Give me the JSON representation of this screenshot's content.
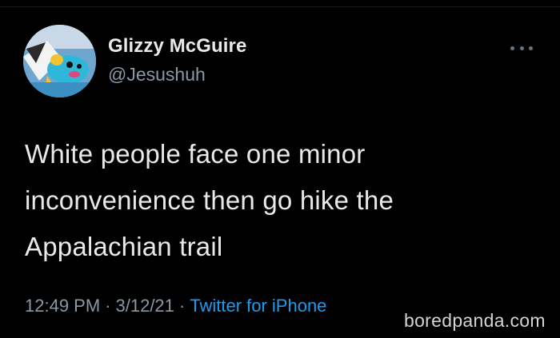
{
  "tweet": {
    "author": {
      "display_name": "Glizzy McGuire",
      "handle": "@Jesushuh",
      "avatar_icon": "avatar-image"
    },
    "more_icon": "more-options-icon",
    "text_lines": [
      "White people face one minor",
      "inconvenience then go hike the",
      "Appalachian trail"
    ],
    "time": "12:49 PM",
    "separator": "·",
    "date": "3/12/21",
    "source": "Twitter for iPhone"
  },
  "watermark": "boredpanda.com",
  "colors": {
    "background": "#000000",
    "primary_text": "#e7e9ea",
    "secondary_text": "#8b98a5",
    "link": "#1d9bf0"
  }
}
